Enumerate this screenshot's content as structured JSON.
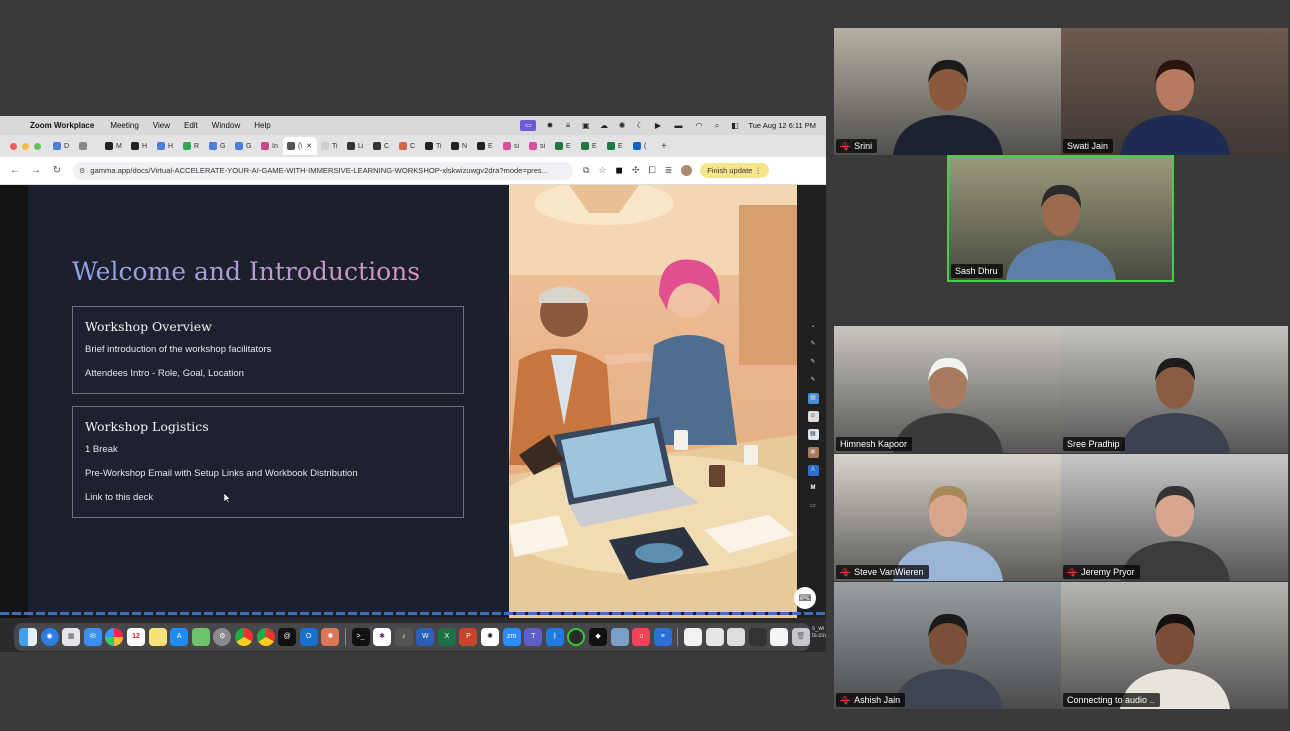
{
  "menubar": {
    "app_name": "Zoom Workplace",
    "items": [
      "Meeting",
      "View",
      "Edit",
      "Window",
      "Help"
    ],
    "clock": "Tue Aug 12  6:11 PM"
  },
  "browser": {
    "tabs": [
      {
        "label": "D",
        "color": "#4a7fe0"
      },
      {
        "label": "",
        "color": "#888"
      },
      {
        "label": "M",
        "color": "#222"
      },
      {
        "label": "H",
        "color": "#222"
      },
      {
        "label": "H",
        "color": "#4a7fe0"
      },
      {
        "label": "R",
        "color": "#34a853"
      },
      {
        "label": "G",
        "color": "#4a7fe0"
      },
      {
        "label": "G",
        "color": "#4a7fe0"
      },
      {
        "label": "In",
        "color": "#c94a8a"
      },
      {
        "label": "(\\",
        "color": "#555"
      },
      {
        "label": "Ti",
        "color": "#ccc"
      },
      {
        "label": "Li",
        "color": "#333"
      },
      {
        "label": "C",
        "color": "#333"
      },
      {
        "label": "C",
        "color": "#d46a4a"
      },
      {
        "label": "Ti",
        "color": "#222"
      },
      {
        "label": "N",
        "color": "#222"
      },
      {
        "label": "E",
        "color": "#222"
      },
      {
        "label": "si",
        "color": "#e04aa0"
      },
      {
        "label": "si",
        "color": "#e04aa0"
      },
      {
        "label": "E",
        "color": "#1d7a3a"
      },
      {
        "label": "E",
        "color": "#1d7a3a"
      },
      {
        "label": "E",
        "color": "#1d7a3a"
      },
      {
        "label": "(",
        "color": "#0a66c2"
      }
    ],
    "active_tab_index": 9,
    "url": "gamma.app/docs/Virtual-ACCELERATE-YOUR-AI-GAME-WITH-IMMERSIVE-LEARNING-WORKSHOP-xlskwizuwgv2dra?mode=pres...",
    "finish_update_label": "Finish update"
  },
  "slide": {
    "title": "Welcome and Introductions",
    "cards": [
      {
        "title": "Workshop Overview",
        "lines": [
          "Brief introduction of the workshop facilitators",
          "Attendees Intro - Role, Goal, Location"
        ]
      },
      {
        "title": "Workshop Logistics",
        "lines": [
          "1 Break",
          "Pre-Workshop Email with Setup Links and Workbook Distribution",
          "Link to this deck"
        ]
      }
    ]
  },
  "dock": {
    "calendar_day": "12",
    "file_label": "s_wi\nts.csv"
  },
  "participants": [
    {
      "name": "Srini",
      "muted": true,
      "speaking": false,
      "bg": "#b5b0a4",
      "shirt": "#1d2230",
      "skin": "#8a5a3e",
      "hair": "#1a1a1a"
    },
    {
      "name": "Swati Jain",
      "muted": false,
      "speaking": false,
      "bg": "#6f5a4e",
      "shirt": "#1e2b52",
      "skin": "#b57a60",
      "hair": "#2a140e"
    },
    {
      "name": "Sash Dhru",
      "muted": false,
      "speaking": true,
      "bg": "#9a9a7a",
      "shirt": "#5b7fa6",
      "skin": "#9c6a4e",
      "hair": "#2a2a2a"
    },
    {
      "name": "Himnesh Kapoor",
      "muted": false,
      "speaking": false,
      "bg": "#c9c6c0",
      "shirt": "#3a3a3a",
      "skin": "#a87b60",
      "hair": "#f2f2f2"
    },
    {
      "name": "Sree Pradhip",
      "muted": false,
      "speaking": false,
      "bg": "#c4c3bf",
      "shirt": "#3c4250",
      "skin": "#8a5c42",
      "hair": "#1c1c1c"
    },
    {
      "name": "Steve VanWieren",
      "muted": true,
      "speaking": false,
      "bg": "#d8d4cc",
      "shirt": "#9ab4d6",
      "skin": "#d8a58a",
      "hair": "#a88a5a"
    },
    {
      "name": "Jeremy Pryor",
      "muted": true,
      "speaking": false,
      "bg": "#c8c8c6",
      "shirt": "#3c3c3c",
      "skin": "#d8a68e",
      "hair": "#333"
    },
    {
      "name": "Ashish Jain",
      "muted": true,
      "speaking": false,
      "bg": "#9a9fa4",
      "shirt": "#3e4654",
      "skin": "#7a5038",
      "hair": "#1a1a1a"
    },
    {
      "name": "Connecting to audio ..",
      "muted": false,
      "speaking": false,
      "bg": "#b8b6b2",
      "shirt": "#e8e4dc",
      "skin": "#7a4e36",
      "hair": "#141010"
    }
  ]
}
